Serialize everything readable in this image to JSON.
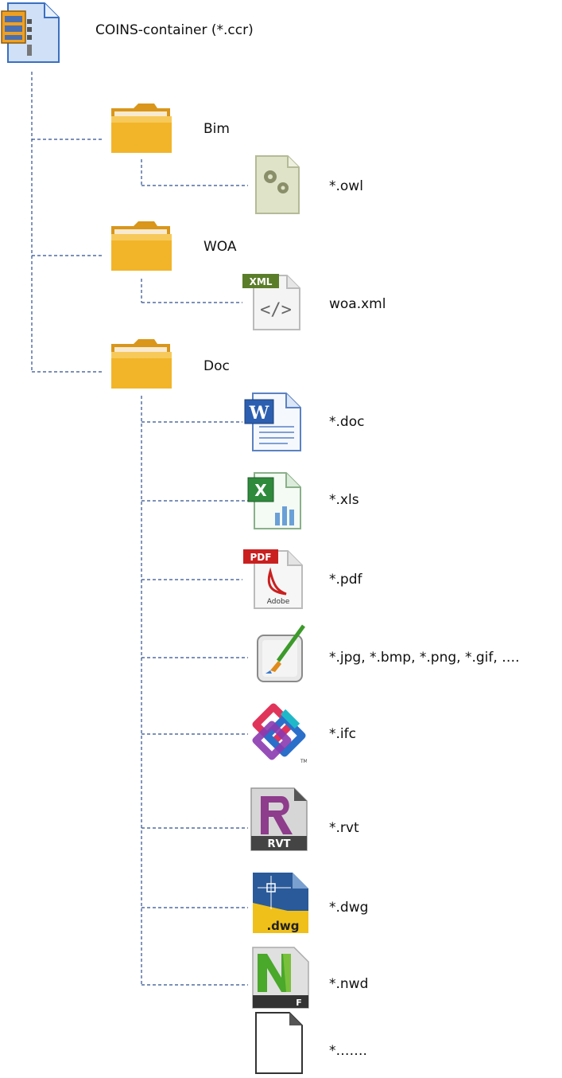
{
  "root": {
    "label": "COINS-container (*.ccr)",
    "icon": "zip-archive-icon"
  },
  "folders": [
    {
      "label": "Bim",
      "icon": "folder-icon",
      "children": [
        {
          "label": "*.owl",
          "icon": "gears-file-icon"
        }
      ]
    },
    {
      "label": "WOA",
      "icon": "folder-icon",
      "children": [
        {
          "label": "woa.xml",
          "icon": "xml-file-icon"
        }
      ]
    },
    {
      "label": "Doc",
      "icon": "folder-icon",
      "children": [
        {
          "label": "*.doc",
          "icon": "word-doc-icon"
        },
        {
          "label": "*.xls",
          "icon": "excel-xls-icon"
        },
        {
          "label": "*.pdf",
          "icon": "pdf-file-icon"
        },
        {
          "label": "*.jpg,  *.bmp,  *.png,  *.gif,  ….",
          "icon": "image-paint-icon"
        },
        {
          "label": "*.ifc",
          "icon": "ifc-logo-icon"
        },
        {
          "label": "*.rvt",
          "icon": "revit-rvt-icon"
        },
        {
          "label": "*.dwg",
          "icon": "autocad-dwg-icon"
        },
        {
          "label": "*.nwd",
          "icon": "navisworks-nwd-icon"
        },
        {
          "label": "*…….",
          "icon": "blank-file-icon"
        }
      ]
    }
  ],
  "colors": {
    "connector": "#2f4f8f",
    "folder": "#f2b529",
    "folder_dark": "#d9961a"
  }
}
